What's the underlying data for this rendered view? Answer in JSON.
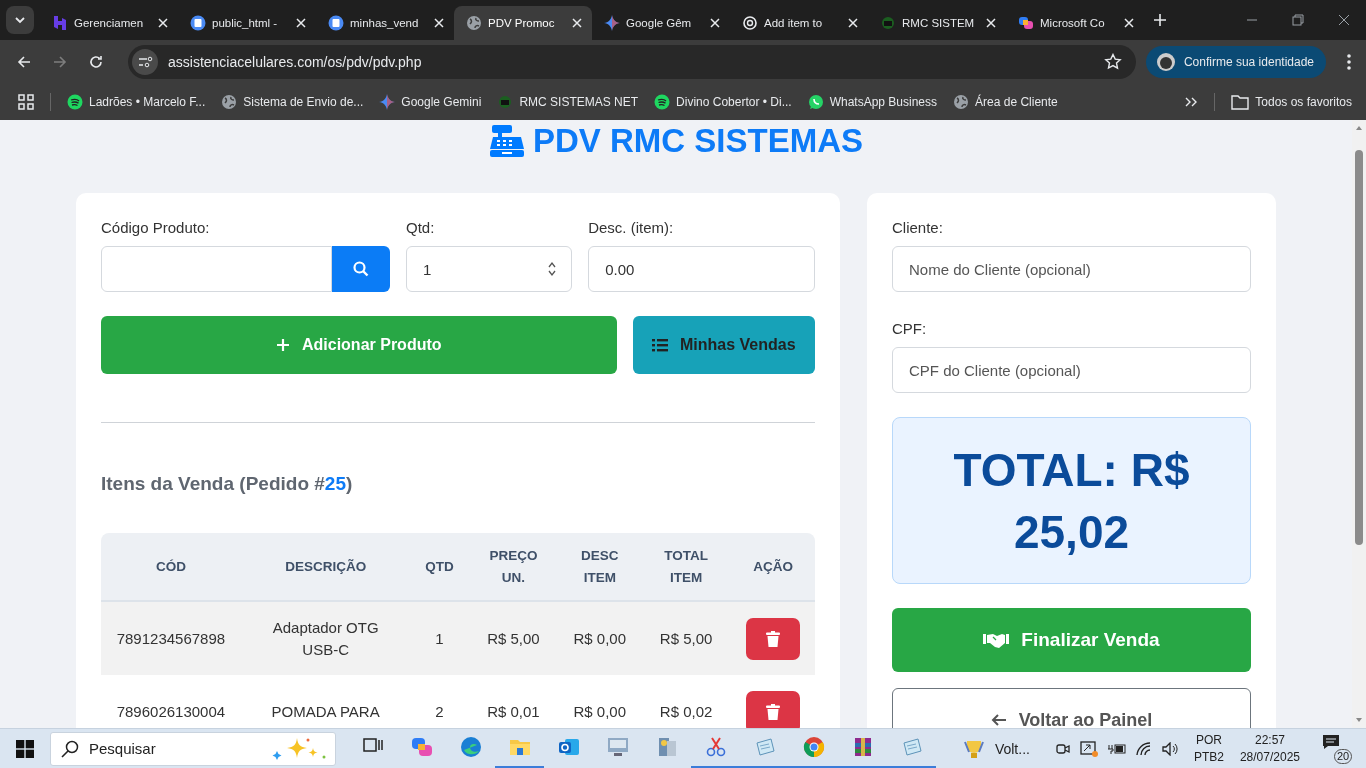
{
  "browser": {
    "tabs": [
      {
        "title": "Gerenciamen",
        "selected": false
      },
      {
        "title": "public_html -",
        "selected": false
      },
      {
        "title": "minhas_vend",
        "selected": false
      },
      {
        "title": "PDV Promoc",
        "selected": true
      },
      {
        "title": "Google Gêm",
        "selected": false
      },
      {
        "title": "Add item to",
        "selected": false
      },
      {
        "title": "RMC SISTEM",
        "selected": false
      },
      {
        "title": "Microsoft Co",
        "selected": false
      }
    ],
    "address": "assistenciacelulares.com/os/pdv/pdv.php",
    "profile_button": "Confirme sua identidade",
    "bookmarks": [
      {
        "label": "Ladrões • Marcelo F..."
      },
      {
        "label": "Sistema de Envio de..."
      },
      {
        "label": "Google Gemini"
      },
      {
        "label": "RMC SISTEMAS NET"
      },
      {
        "label": "Divino Cobertor • Di..."
      },
      {
        "label": "WhatsApp Business"
      },
      {
        "label": "Área de Cliente"
      }
    ],
    "all_bookmarks": "Todos os favoritos"
  },
  "page": {
    "title": "PDV RMC SISTEMAS",
    "product_code": {
      "label": "Código Produto:"
    },
    "quantity": {
      "label": "Qtd:",
      "value": "1"
    },
    "discount": {
      "label": "Desc. (item):",
      "value": "0.00"
    },
    "add_button": "Adicionar Produto",
    "sales_button": "Minhas Vendas",
    "items_title": "Itens da Venda (Pedido #",
    "order_number": "25",
    "items_title_end": ")",
    "table": {
      "columns": [
        "CÓD",
        "DESCRIÇÃO",
        "QTD",
        "PREÇO UN.",
        "DESC ITEM",
        "TOTAL ITEM",
        "AÇÃO"
      ],
      "rows": [
        {
          "cells": [
            "7891234567898",
            "Adaptador OTG USB-C",
            "1",
            "R$ 5,00",
            "R$ 0,00",
            "R$ 5,00"
          ]
        },
        {
          "cells": [
            "7896026130004",
            "POMADA PARA",
            "2",
            "R$ 0,01",
            "R$ 0,00",
            "R$ 0,02"
          ]
        }
      ]
    },
    "client": {
      "label": "Cliente:",
      "placeholder": "Nome do Cliente (opcional)"
    },
    "cpf": {
      "label": "CPF:",
      "placeholder": "CPF do Cliente (opcional)"
    },
    "total": "TOTAL: R$ 25,02",
    "finalize_button": "Finalizar Venda",
    "back_button": "Voltar ao Painel"
  },
  "taskbar": {
    "search_placeholder": "Pesquisar",
    "apps": [
      {
        "kind": "taskview",
        "running": false
      },
      {
        "kind": "copilot",
        "running": false
      },
      {
        "kind": "edge",
        "running": false
      },
      {
        "kind": "folder",
        "running": true
      },
      {
        "kind": "outlook",
        "running": false
      },
      {
        "kind": "computer",
        "running": false
      },
      {
        "kind": "server",
        "running": false
      },
      {
        "kind": "snip",
        "running": true
      },
      {
        "kind": "notepad",
        "running": true
      },
      {
        "kind": "chrome",
        "running": true
      },
      {
        "kind": "archive",
        "running": true
      },
      {
        "kind": "notepad",
        "running": true
      }
    ],
    "weather": "Volt...",
    "language": "POR",
    "layout": "PTB2",
    "time": "22:57",
    "date": "28/07/2025",
    "notifications": "20"
  }
}
